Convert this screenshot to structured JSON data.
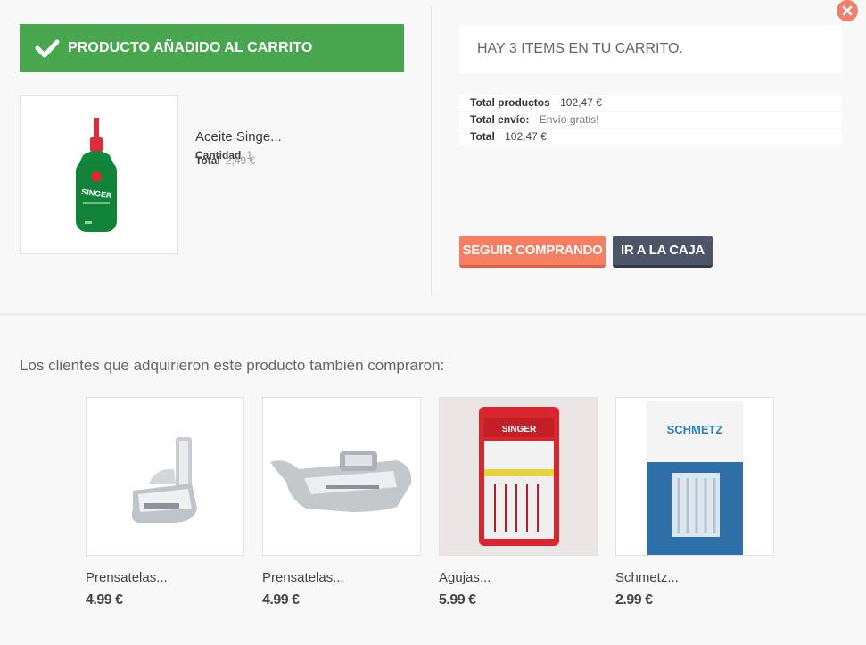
{
  "header": {
    "success_message": "PRODUCTO AÑADIDO AL CARRITO",
    "cart_count_message": "HAY 3 ITEMS EN TU CARRITO."
  },
  "added_product": {
    "name": "Aceite Singe...",
    "quantity_label": "Cantidad",
    "quantity_value": "1",
    "total_label": "Total",
    "total_value": "2,49 €"
  },
  "summary": {
    "products_label": "Total productos",
    "products_value": "102,47 €",
    "shipping_label": "Total envío:",
    "shipping_value": "Envío gratis!",
    "total_label": "Total",
    "total_value": "102,47 €"
  },
  "buttons": {
    "continue": "SEGUIR COMPRANDO",
    "checkout": "IR A LA CAJA"
  },
  "also_bought": {
    "title": "Los clientes que adquirieron este producto también compraron:",
    "items": [
      {
        "name": "Prensatelas...",
        "price": "4.99 €"
      },
      {
        "name": "Prensatelas...",
        "price": "4.99 €"
      },
      {
        "name": "Agujas...",
        "price": "5.99 €"
      },
      {
        "name": "Schmetz...",
        "price": "2.99 €"
      }
    ]
  },
  "colors": {
    "success": "#48a64e",
    "continue_button": "#f67e62",
    "checkout_button": "#4d5568",
    "close_button": "#f07f6d"
  },
  "icons": {
    "close": "close-icon",
    "check": "check-icon"
  }
}
